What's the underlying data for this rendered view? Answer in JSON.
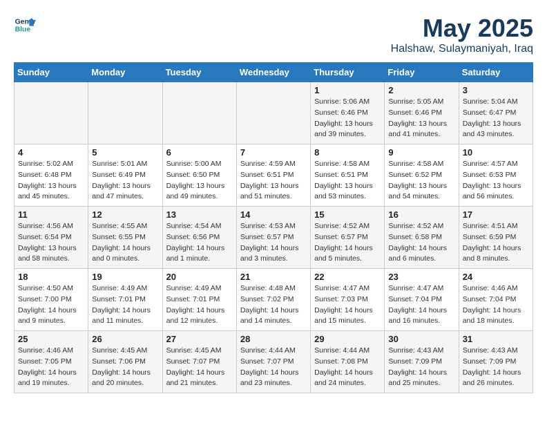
{
  "header": {
    "logo_line1": "General",
    "logo_line2": "Blue",
    "month": "May 2025",
    "location": "Halshaw, Sulaymaniyah, Iraq"
  },
  "weekdays": [
    "Sunday",
    "Monday",
    "Tuesday",
    "Wednesday",
    "Thursday",
    "Friday",
    "Saturday"
  ],
  "weeks": [
    [
      {
        "day": "",
        "info": ""
      },
      {
        "day": "",
        "info": ""
      },
      {
        "day": "",
        "info": ""
      },
      {
        "day": "",
        "info": ""
      },
      {
        "day": "1",
        "info": "Sunrise: 5:06 AM\nSunset: 6:46 PM\nDaylight: 13 hours\nand 39 minutes."
      },
      {
        "day": "2",
        "info": "Sunrise: 5:05 AM\nSunset: 6:46 PM\nDaylight: 13 hours\nand 41 minutes."
      },
      {
        "day": "3",
        "info": "Sunrise: 5:04 AM\nSunset: 6:47 PM\nDaylight: 13 hours\nand 43 minutes."
      }
    ],
    [
      {
        "day": "4",
        "info": "Sunrise: 5:02 AM\nSunset: 6:48 PM\nDaylight: 13 hours\nand 45 minutes."
      },
      {
        "day": "5",
        "info": "Sunrise: 5:01 AM\nSunset: 6:49 PM\nDaylight: 13 hours\nand 47 minutes."
      },
      {
        "day": "6",
        "info": "Sunrise: 5:00 AM\nSunset: 6:50 PM\nDaylight: 13 hours\nand 49 minutes."
      },
      {
        "day": "7",
        "info": "Sunrise: 4:59 AM\nSunset: 6:51 PM\nDaylight: 13 hours\nand 51 minutes."
      },
      {
        "day": "8",
        "info": "Sunrise: 4:58 AM\nSunset: 6:51 PM\nDaylight: 13 hours\nand 53 minutes."
      },
      {
        "day": "9",
        "info": "Sunrise: 4:58 AM\nSunset: 6:52 PM\nDaylight: 13 hours\nand 54 minutes."
      },
      {
        "day": "10",
        "info": "Sunrise: 4:57 AM\nSunset: 6:53 PM\nDaylight: 13 hours\nand 56 minutes."
      }
    ],
    [
      {
        "day": "11",
        "info": "Sunrise: 4:56 AM\nSunset: 6:54 PM\nDaylight: 13 hours\nand 58 minutes."
      },
      {
        "day": "12",
        "info": "Sunrise: 4:55 AM\nSunset: 6:55 PM\nDaylight: 14 hours\nand 0 minutes."
      },
      {
        "day": "13",
        "info": "Sunrise: 4:54 AM\nSunset: 6:56 PM\nDaylight: 14 hours\nand 1 minute."
      },
      {
        "day": "14",
        "info": "Sunrise: 4:53 AM\nSunset: 6:57 PM\nDaylight: 14 hours\nand 3 minutes."
      },
      {
        "day": "15",
        "info": "Sunrise: 4:52 AM\nSunset: 6:57 PM\nDaylight: 14 hours\nand 5 minutes."
      },
      {
        "day": "16",
        "info": "Sunrise: 4:52 AM\nSunset: 6:58 PM\nDaylight: 14 hours\nand 6 minutes."
      },
      {
        "day": "17",
        "info": "Sunrise: 4:51 AM\nSunset: 6:59 PM\nDaylight: 14 hours\nand 8 minutes."
      }
    ],
    [
      {
        "day": "18",
        "info": "Sunrise: 4:50 AM\nSunset: 7:00 PM\nDaylight: 14 hours\nand 9 minutes."
      },
      {
        "day": "19",
        "info": "Sunrise: 4:49 AM\nSunset: 7:01 PM\nDaylight: 14 hours\nand 11 minutes."
      },
      {
        "day": "20",
        "info": "Sunrise: 4:49 AM\nSunset: 7:01 PM\nDaylight: 14 hours\nand 12 minutes."
      },
      {
        "day": "21",
        "info": "Sunrise: 4:48 AM\nSunset: 7:02 PM\nDaylight: 14 hours\nand 14 minutes."
      },
      {
        "day": "22",
        "info": "Sunrise: 4:47 AM\nSunset: 7:03 PM\nDaylight: 14 hours\nand 15 minutes."
      },
      {
        "day": "23",
        "info": "Sunrise: 4:47 AM\nSunset: 7:04 PM\nDaylight: 14 hours\nand 16 minutes."
      },
      {
        "day": "24",
        "info": "Sunrise: 4:46 AM\nSunset: 7:04 PM\nDaylight: 14 hours\nand 18 minutes."
      }
    ],
    [
      {
        "day": "25",
        "info": "Sunrise: 4:46 AM\nSunset: 7:05 PM\nDaylight: 14 hours\nand 19 minutes."
      },
      {
        "day": "26",
        "info": "Sunrise: 4:45 AM\nSunset: 7:06 PM\nDaylight: 14 hours\nand 20 minutes."
      },
      {
        "day": "27",
        "info": "Sunrise: 4:45 AM\nSunset: 7:07 PM\nDaylight: 14 hours\nand 21 minutes."
      },
      {
        "day": "28",
        "info": "Sunrise: 4:44 AM\nSunset: 7:07 PM\nDaylight: 14 hours\nand 23 minutes."
      },
      {
        "day": "29",
        "info": "Sunrise: 4:44 AM\nSunset: 7:08 PM\nDaylight: 14 hours\nand 24 minutes."
      },
      {
        "day": "30",
        "info": "Sunrise: 4:43 AM\nSunset: 7:09 PM\nDaylight: 14 hours\nand 25 minutes."
      },
      {
        "day": "31",
        "info": "Sunrise: 4:43 AM\nSunset: 7:09 PM\nDaylight: 14 hours\nand 26 minutes."
      }
    ]
  ]
}
